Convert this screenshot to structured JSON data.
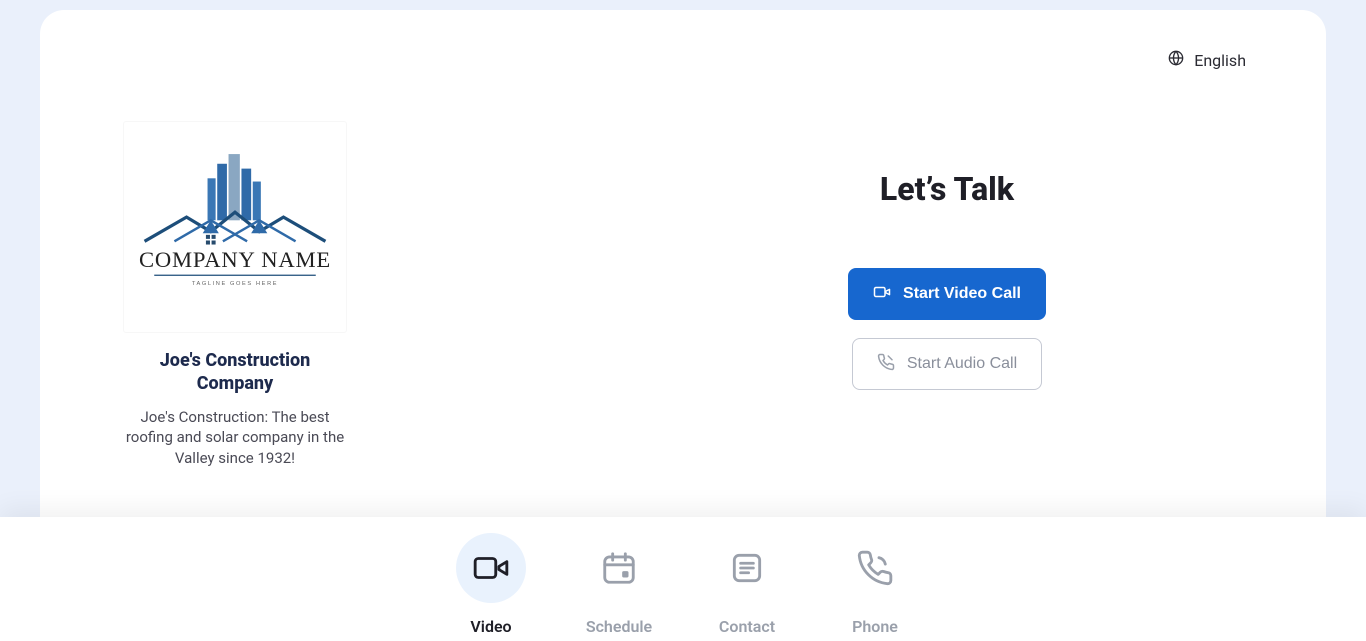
{
  "language": {
    "label": "English"
  },
  "company": {
    "name": "Joe's Construction Company",
    "description": "Joe's Construction: The best roofing and solar company in the Valley since 1932!",
    "logo_text": "COMPANY NAME",
    "logo_tagline": "TAGLINE GOES HERE"
  },
  "main": {
    "heading": "Let’s Talk",
    "video_button": "Start Video Call",
    "audio_button": "Start Audio Call"
  },
  "nav": {
    "items": [
      {
        "label": "Video",
        "active": true
      },
      {
        "label": "Schedule",
        "active": false
      },
      {
        "label": "Contact",
        "active": false
      },
      {
        "label": "Phone",
        "active": false
      }
    ]
  },
  "colors": {
    "primary": "#1767cf",
    "page_bg": "#eaf0fb"
  }
}
